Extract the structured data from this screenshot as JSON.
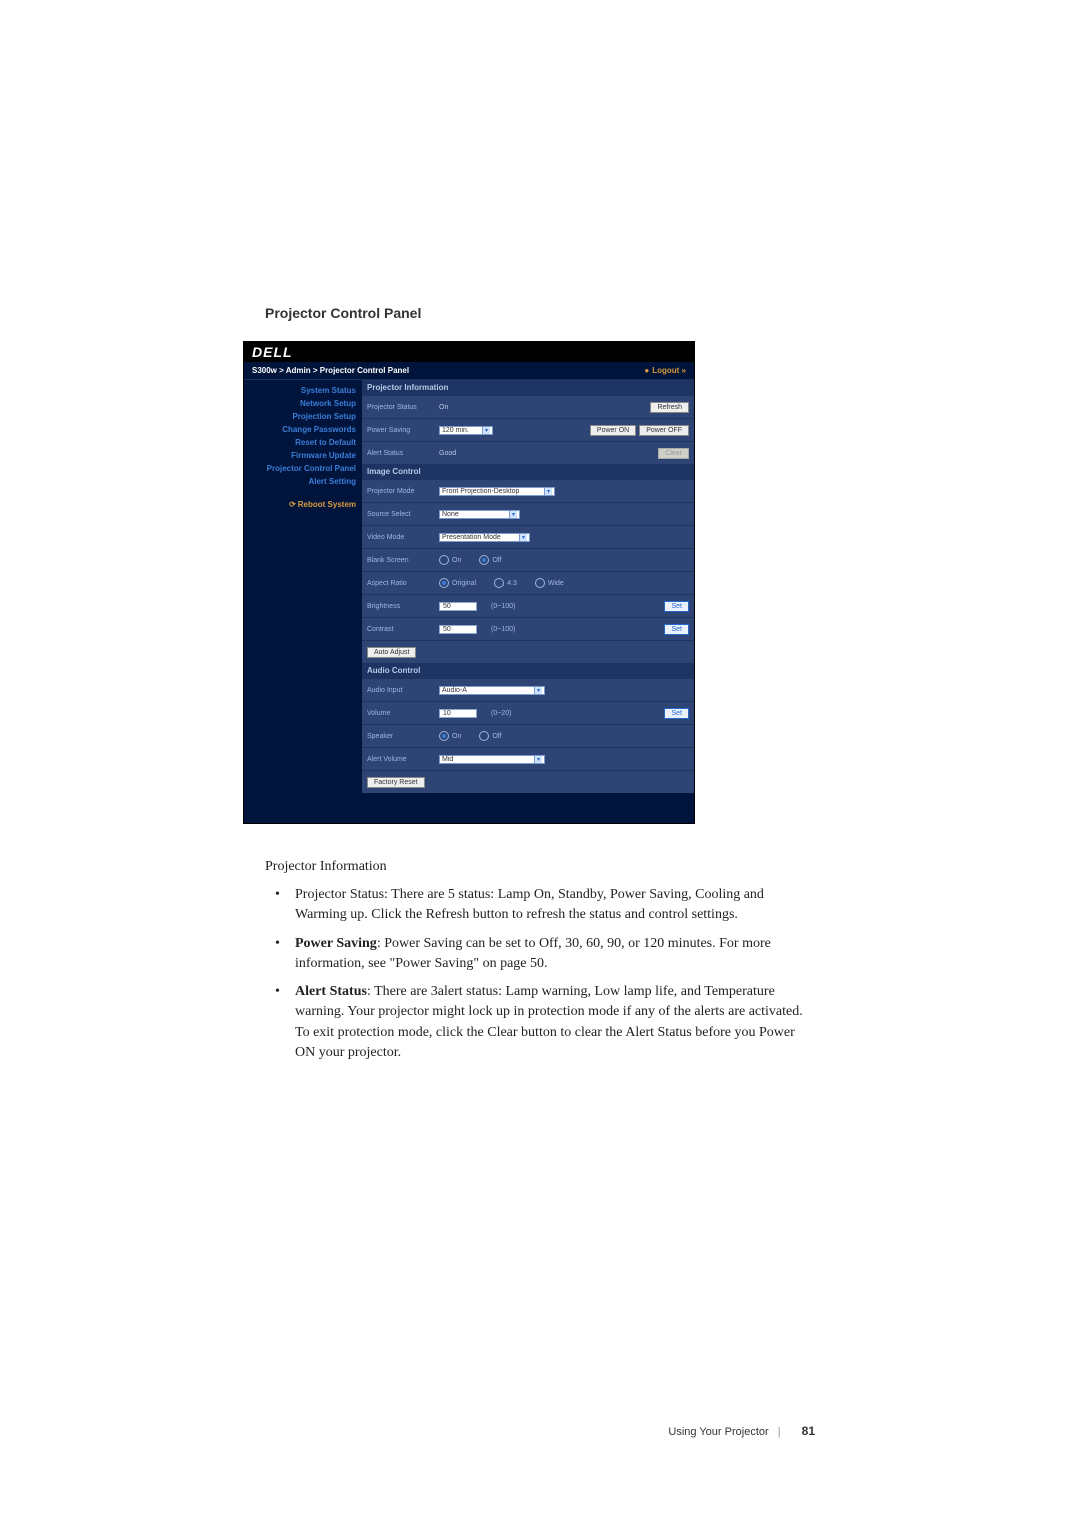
{
  "heading": "Projector Control Panel",
  "panel": {
    "logo": "DELL",
    "breadcrumb": "S300w > Admin > Projector Control Panel",
    "logout": "Logout »",
    "sidebar": {
      "items": [
        "System Status",
        "Network Setup",
        "Projection Setup",
        "Change Passwords",
        "Reset to Default",
        "Firmware Update",
        "Projector Control Panel",
        "Alert Setting"
      ],
      "reboot": "Reboot System"
    },
    "groups": {
      "info_header": "Projector Information",
      "projector_status": {
        "label": "Projector Status",
        "value": "On",
        "refresh": "Refresh"
      },
      "power_saving": {
        "label": "Power Saving",
        "value": "120 min.",
        "on": "Power ON",
        "off": "Power OFF"
      },
      "alert_status": {
        "label": "Alert Status",
        "value": "Good",
        "clear": "Clear"
      },
      "image_header": "Image Control",
      "projector_mode": {
        "label": "Projector Mode",
        "value": "Front Projection-Desktop"
      },
      "source_select": {
        "label": "Source Select",
        "value": "None"
      },
      "video_mode": {
        "label": "Video Mode",
        "value": "Presentation Mode"
      },
      "blank_screen": {
        "label": "Blank Screen",
        "on": "On",
        "off": "Off"
      },
      "aspect_ratio": {
        "label": "Aspect Ratio",
        "original": "Original",
        "r43": "4:3",
        "wide": "Wide"
      },
      "brightness": {
        "label": "Brightness",
        "value": "50",
        "range": "(0~100)",
        "set": "Set"
      },
      "contrast": {
        "label": "Contrast",
        "value": "50",
        "range": "(0~100)",
        "set": "Set"
      },
      "auto_adjust": "Auto Adjust",
      "audio_header": "Audio Control",
      "audio_input": {
        "label": "Audio Input",
        "value": "Audio-A"
      },
      "volume": {
        "label": "Volume",
        "value": "10",
        "range": "(0~20)",
        "set": "Set"
      },
      "speaker": {
        "label": "Speaker",
        "on": "On",
        "off": "Off"
      },
      "alert_volume": {
        "label": "Alert Volume",
        "value": "Mid"
      },
      "factory_reset": "Factory Reset"
    }
  },
  "body": {
    "sub_heading": "Projector Information",
    "bullet1": "Projector Status: There are 5 status: Lamp On, Standby, Power Saving, Cooling and Warming up. Click the Refresh button to refresh the status and control settings.",
    "bullet2_bold": "Power Saving",
    "bullet2_rest": ": Power Saving can be set to Off, 30, 60, 90, or 120 minutes. For more information, see \"Power Saving\" on page 50.",
    "bullet3_bold": "Alert Status",
    "bullet3_rest": ": There are 3alert status: Lamp warning, Low lamp life, and Temperature warning. Your projector might lock up in protection mode if any of the alerts are activated. To exit protection mode, click the Clear button to clear the Alert Status before you Power ON your projector."
  },
  "footer": {
    "section": "Using Your Projector",
    "page": "81"
  }
}
